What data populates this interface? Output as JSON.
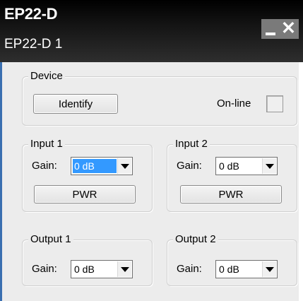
{
  "window": {
    "title": "EP22-D",
    "subtitle": "EP22-D 1",
    "minimize_glyph": "_",
    "close_glyph": "✕"
  },
  "device": {
    "legend": "Device",
    "identify_label": "Identify",
    "online_label": "On-line"
  },
  "input1": {
    "legend": "Input 1",
    "gain_label": "Gain:",
    "gain_value": "0 dB",
    "pwr_label": "PWR"
  },
  "input2": {
    "legend": "Input 2",
    "gain_label": "Gain:",
    "gain_value": "0 dB",
    "pwr_label": "PWR"
  },
  "output1": {
    "legend": "Output 1",
    "gain_label": "Gain:",
    "gain_value": "0 dB"
  },
  "output2": {
    "legend": "Output 2",
    "gain_label": "Gain:",
    "gain_value": "0 dB"
  },
  "colors": {
    "selection": "#3399ff",
    "panel": "#ececec",
    "titlebar": "#000000"
  }
}
